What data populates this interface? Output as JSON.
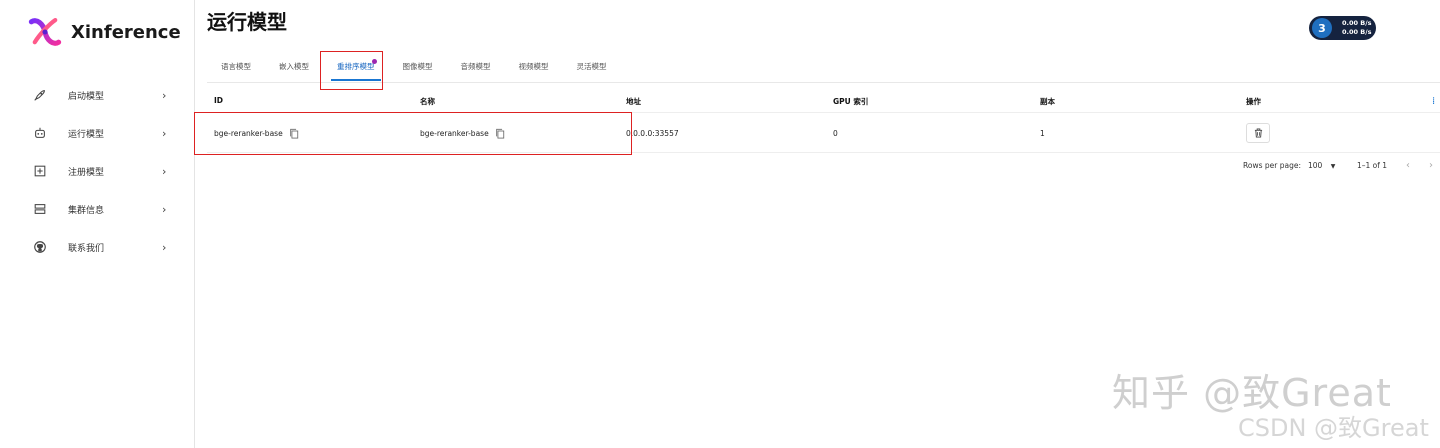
{
  "app": {
    "name": "Xinference"
  },
  "sidebar": {
    "items": [
      {
        "label": "启动模型",
        "icon": "rocket-icon"
      },
      {
        "label": "运行模型",
        "icon": "robot-icon"
      },
      {
        "label": "注册模型",
        "icon": "add-box-icon"
      },
      {
        "label": "集群信息",
        "icon": "storage-icon"
      },
      {
        "label": "联系我们",
        "icon": "github-icon"
      }
    ],
    "chevron": "›"
  },
  "header": {
    "title": "运行模型",
    "net_up": "0.00 B/s",
    "net_down": "0.00 B/s",
    "net_badge_num": "3"
  },
  "tabs": [
    {
      "label": "语言模型"
    },
    {
      "label": "嵌入模型"
    },
    {
      "label": "重排序模型",
      "active": true
    },
    {
      "label": "图像模型"
    },
    {
      "label": "音频模型"
    },
    {
      "label": "视频模型"
    },
    {
      "label": "灵活模型"
    }
  ],
  "table": {
    "columns": [
      "ID",
      "名称",
      "地址",
      "GPU 索引",
      "副本",
      "操作"
    ],
    "rows": [
      {
        "id": "bge-reranker-base",
        "name": "bge-reranker-base",
        "address": "0.0.0.0:33557",
        "gpu_index": "0",
        "replica": "1"
      }
    ]
  },
  "pagination": {
    "rows_per_page_label": "Rows per page:",
    "rows_per_page_value": "100",
    "range": "1–1 of 1"
  },
  "watermark": {
    "zhihu": "知乎 @致Great",
    "csdn": "CSDN @致Great"
  },
  "colors": {
    "accent": "#1976d2",
    "highlight_box": "#dd2222",
    "tab_dot": "#9c27b0",
    "badge_bg": "#15233f"
  }
}
